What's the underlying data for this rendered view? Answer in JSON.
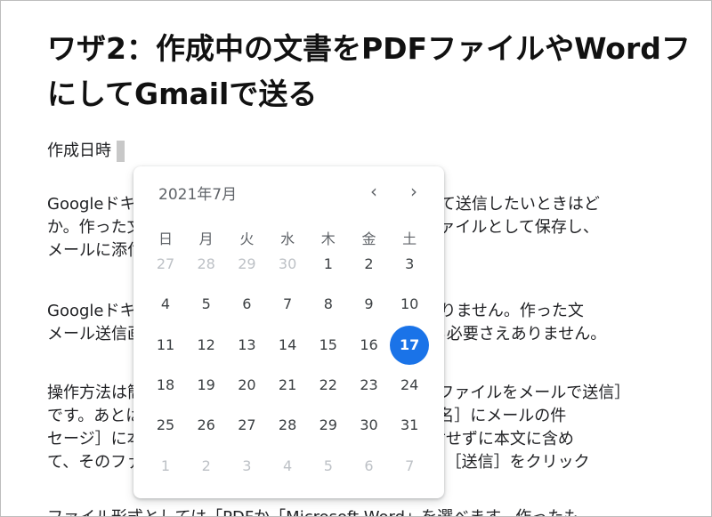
{
  "document": {
    "title_lines": [
      "ワザ2：作成中の文書をPDFファイルやWordフ",
      "にしてGmailで送る"
    ],
    "created_label": "作成日時",
    "paragraphs": [
      [
        "Googleドキュメントで作成した文書をメールに添付して送信したいときはど",
        "か。作った文書をPDFやWordなどの形式に変換してファイルとして保存し、",
        "メールに添付する必要があるでしょうか。"
      ],
      [
        "Googleドキュメントなら、そうした変換作業は必要ありません。作った文",
        "メール送信画面を呼び出せるので、メールを切り替える必要さえありません。"
      ],
      [
        "操作方法は簡単です。［ファイル］メニューから［このファイルをメールで送信］",
        "です。あとは［宛先］に送信先のメールアドレス、［件名］にメールの件",
        "セージ］に本文を入力します。ファイルをメールに添付せずに本文に含め",
        "て、そのファイル形式（PDFなど）を一覧から選択して［送信］をクリック"
      ],
      [
        "ファイル形式としては「PDFか「Microsoft Word」を選べます。作ったも"
      ]
    ]
  },
  "date_picker": {
    "month_label": "2021年7月",
    "prev_icon": "‹",
    "next_icon": "›",
    "weekdays": [
      "日",
      "月",
      "火",
      "水",
      "木",
      "金",
      "土"
    ],
    "weeks": [
      [
        {
          "d": "27",
          "out": true
        },
        {
          "d": "28",
          "out": true
        },
        {
          "d": "29",
          "out": true
        },
        {
          "d": "30",
          "out": true
        },
        {
          "d": "1"
        },
        {
          "d": "2"
        },
        {
          "d": "3"
        }
      ],
      [
        {
          "d": "4"
        },
        {
          "d": "5"
        },
        {
          "d": "6"
        },
        {
          "d": "7"
        },
        {
          "d": "8"
        },
        {
          "d": "9"
        },
        {
          "d": "10"
        }
      ],
      [
        {
          "d": "11"
        },
        {
          "d": "12"
        },
        {
          "d": "13"
        },
        {
          "d": "14"
        },
        {
          "d": "15"
        },
        {
          "d": "16"
        },
        {
          "d": "17",
          "selected": true
        }
      ],
      [
        {
          "d": "18"
        },
        {
          "d": "19"
        },
        {
          "d": "20"
        },
        {
          "d": "21"
        },
        {
          "d": "22"
        },
        {
          "d": "23"
        },
        {
          "d": "24"
        }
      ],
      [
        {
          "d": "25"
        },
        {
          "d": "26"
        },
        {
          "d": "27"
        },
        {
          "d": "28"
        },
        {
          "d": "29"
        },
        {
          "d": "30"
        },
        {
          "d": "31"
        }
      ],
      [
        {
          "d": "1",
          "out": true
        },
        {
          "d": "2",
          "out": true
        },
        {
          "d": "3",
          "out": true
        },
        {
          "d": "4",
          "out": true
        },
        {
          "d": "5",
          "out": true
        },
        {
          "d": "6",
          "out": true
        },
        {
          "d": "7",
          "out": true
        }
      ]
    ],
    "accent_color": "#1a73e8"
  }
}
